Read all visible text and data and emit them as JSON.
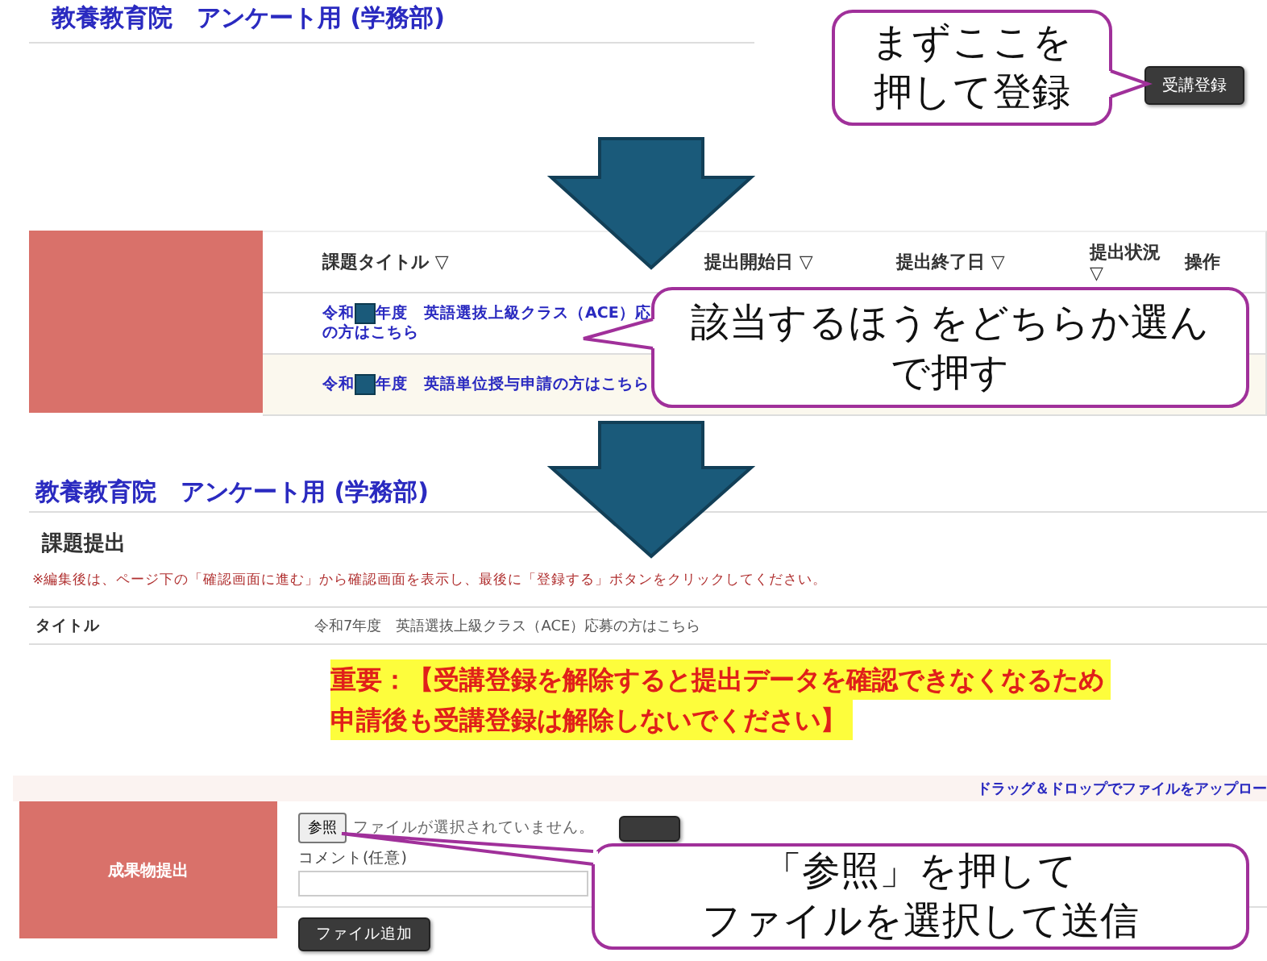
{
  "step1": {
    "title": "教養教育院　アンケート用 (学務部)",
    "button": "受講登録"
  },
  "step2": {
    "columns": [
      "課題タイトル ▽",
      "提出開始日 ▽",
      "提出終了日 ▽",
      "提出状況 ▽",
      "操作"
    ],
    "rows": [
      {
        "prefix": "令和",
        "lines": [
          "年度　英語選抜上級クラス（ACE）応",
          "の方はこちら"
        ]
      },
      {
        "prefix": "令和",
        "lines": [
          "年度　英語単位授与申請の方はこちら"
        ]
      }
    ]
  },
  "step3": {
    "title": "教養教育院　アンケート用 (学務部)",
    "section": "課題提出",
    "note": "※編集後は、ページ下の「確認画面に進む」から確認画面を表示し、最後に「登録する」ボタンをクリックしてください。",
    "field_label": "タイトル",
    "field_value": "令和7年度　英語選抜上級クラス（ACE）応募の方はこちら",
    "warning_lines": [
      "重要：【受講登録を解除すると提出データを確認できなくなるため",
      "申請後も受講登録は解除しないでください】"
    ]
  },
  "step4": {
    "hint": "ドラッグ＆ドロップでファイルをアップロー",
    "label": "成果物提出",
    "browse_button": "参照",
    "file_status": "ファイルが選択されていません。",
    "comment_label": "コメント(任意)",
    "add_button": "ファイル追加"
  },
  "callouts": [
    {
      "lines": [
        "まずここを",
        "押して登録"
      ]
    },
    {
      "lines": [
        "該当するほうをどちらか選ん",
        "で押す"
      ]
    },
    {
      "lines": [
        "「参照」を押して",
        "ファイルを選択して送信"
      ]
    }
  ]
}
